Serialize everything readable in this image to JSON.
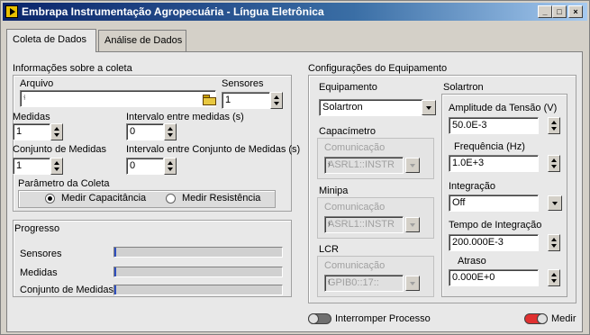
{
  "window": {
    "title": "Embrapa Instrumentação Agropecuária - Língua Eletrônica",
    "controls": {
      "minimize": "_",
      "maximize": "□",
      "close": "×"
    }
  },
  "tabs": [
    {
      "label": "Coleta de Dados",
      "active": true
    },
    {
      "label": "Análise de Dados",
      "active": false
    }
  ],
  "info": {
    "title": "Informações sobre a coleta",
    "arquivo_label": "Arquivo",
    "arquivo_value": "",
    "arquivo_icon": "path-icon",
    "sensores_label": "Sensores",
    "sensores_value": "1",
    "medidas_label": "Medidas",
    "medidas_value": "1",
    "intervalo_label": "Intervalo entre medidas (s)",
    "intervalo_value": "0",
    "conjunto_label": "Conjunto de Medidas",
    "conjunto_value": "1",
    "intervalo_conj_label": "Intervalo entre Conjunto de Medidas (s)",
    "intervalo_conj_value": "0",
    "parametro_label": "Parâmetro da Coleta",
    "radio_capacitancia": "Medir Capacitância",
    "radio_resistencia": "Medir Resistência",
    "selected": "capacitancia"
  },
  "progresso": {
    "title": "Progresso",
    "items": [
      {
        "label": "Sensores",
        "value": 0
      },
      {
        "label": "Medidas",
        "value": 0
      },
      {
        "label": "Conjunto de Medidas",
        "value": 0
      }
    ]
  },
  "config": {
    "title": "Configurações do Equipamento",
    "equipamento_label": "Equipamento",
    "equipamento_value": "Solartron",
    "capacimetro_label": "Capacímetro",
    "capacimetro_com_label": "Comunicação",
    "capacimetro_com_value": "ASRL1::INSTR",
    "minipa_label": "Minipa",
    "minipa_com_label": "Comunicação",
    "minipa_com_value": "ASRL1::INSTR",
    "lcr_label": "LCR",
    "lcr_com_label": "Comunicação",
    "lcr_com_value": "GPIB0::17::",
    "solartron_label": "Solartron",
    "amplitude_label": "Amplitude da Tensão (V)",
    "amplitude_value": "50.0E-3",
    "frequencia_label": "Frequência (Hz)",
    "frequencia_value": "1.0E+3",
    "integracao_label": "Integração",
    "integracao_value": "Off",
    "tempo_label": "Tempo de Integração",
    "tempo_value": "200.000E-3",
    "atraso_label": "Atraso",
    "atraso_value": "0.000E+0"
  },
  "actions": {
    "interromper_label": "Interromper Processo",
    "medir_label": "Medir",
    "interromper_color": "#707070",
    "medir_color": "#e03030"
  }
}
